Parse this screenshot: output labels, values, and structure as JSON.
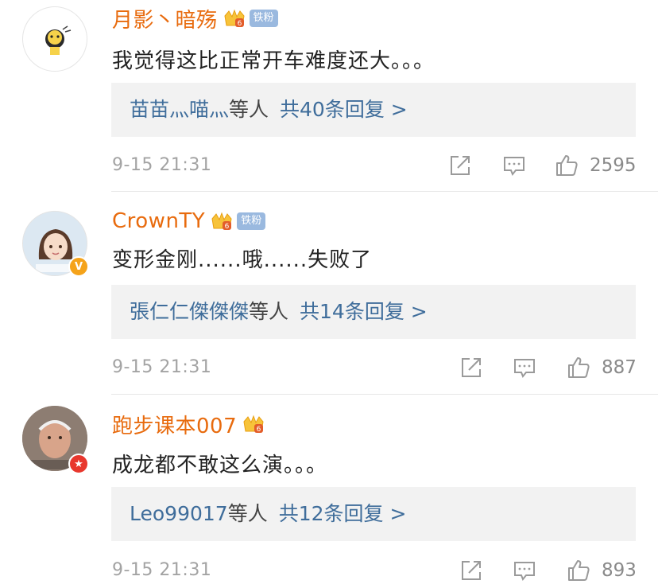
{
  "comments": [
    {
      "username": "月影丶暗殇",
      "fan_badge": "铁粉",
      "has_fan_badge": true,
      "verified": false,
      "text": "我觉得这比正常开车难度还大。。。",
      "reply_names": "苗苗灬喵灬",
      "reply_others": "等人",
      "reply_total": "共40条回复 >",
      "time": "9-15 21:31",
      "likes": "2595"
    },
    {
      "username": "CrownTY",
      "fan_badge": "铁粉",
      "has_fan_badge": true,
      "verified": true,
      "verified_color": "#f5a31a",
      "text": "变形金刚......哦......失败了",
      "reply_names": "張仁仁傑傑傑",
      "reply_others": "等人",
      "reply_total": "共14条回复 >",
      "time": "9-15 21:31",
      "likes": "887"
    },
    {
      "username": "跑步课本007",
      "has_fan_badge": false,
      "verified": true,
      "verified_color": "#e8372d",
      "text": "成龙都不敢这么演。。。",
      "reply_names": "Leo99017",
      "reply_others": "等人",
      "reply_total": "共12条回复 >",
      "time": "9-15 21:31",
      "likes": "893"
    }
  ],
  "icons": {
    "share": "share-icon",
    "comment": "comment-icon",
    "like": "thumbs-up-icon",
    "crown": "crown-icon"
  },
  "colors": {
    "username": "#e86b0e",
    "reply_link": "#3f6d9b",
    "meta_gray": "#a3a3a3",
    "fan_badge_bg": "#9ab9df"
  }
}
